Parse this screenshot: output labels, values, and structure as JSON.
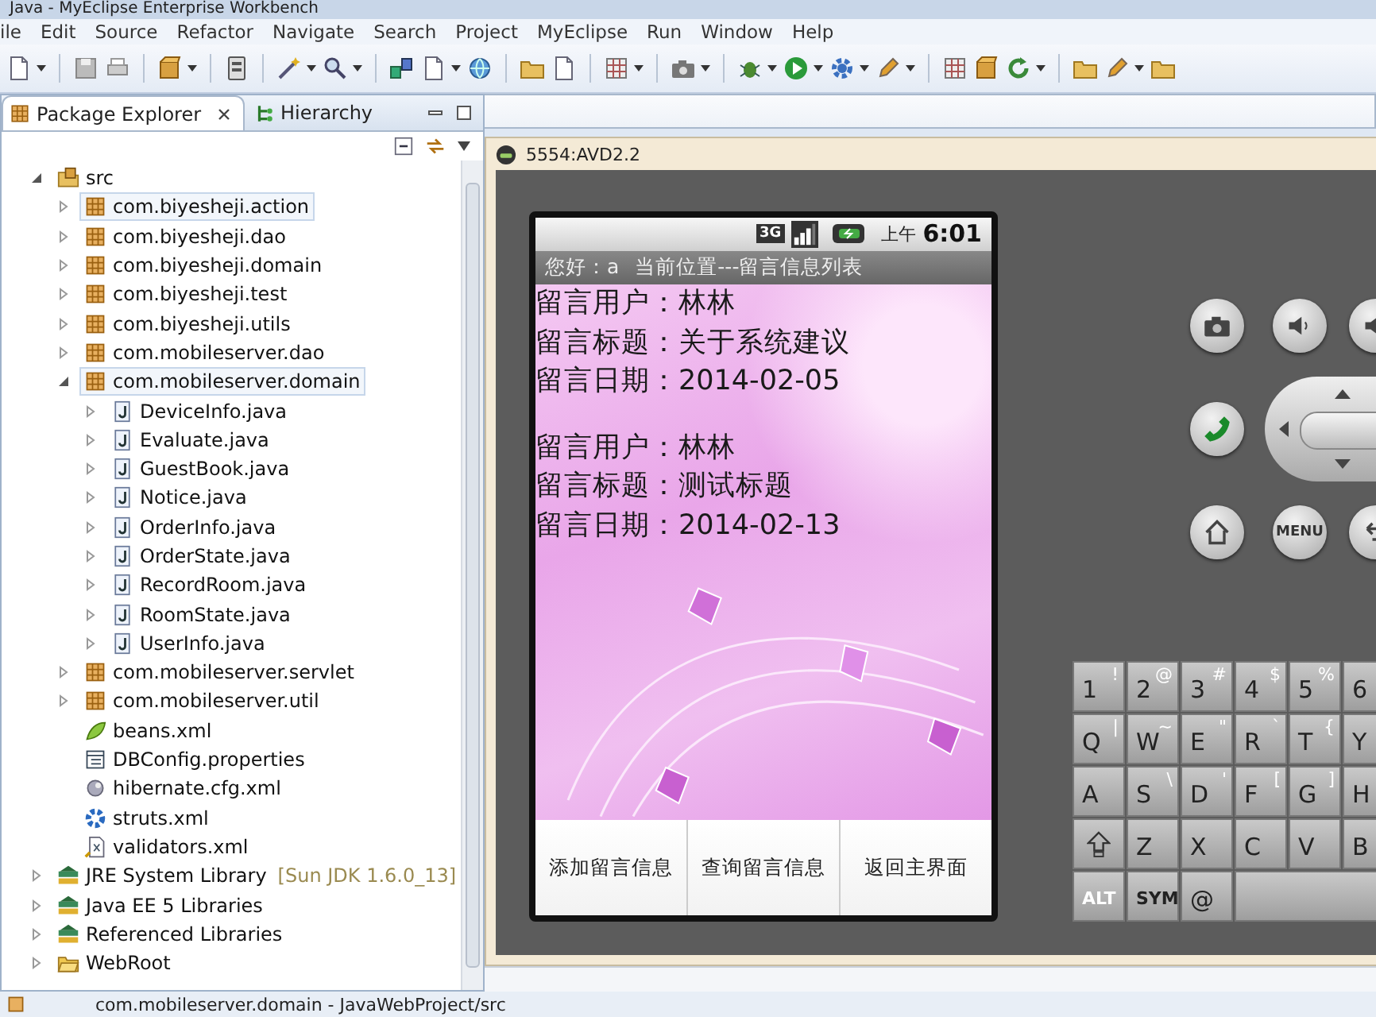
{
  "window": {
    "title": "Java - MyEclipse Enterprise Workbench"
  },
  "menu": [
    "ile",
    "Edit",
    "Source",
    "Refactor",
    "Navigate",
    "Search",
    "Project",
    "MyEclipse",
    "Run",
    "Window",
    "Help"
  ],
  "explorer": {
    "tabs": [
      {
        "label": "Package Explorer",
        "selected": true
      },
      {
        "label": "Hierarchy",
        "selected": false
      }
    ],
    "tree": [
      {
        "label": "src",
        "kind": "source-folder",
        "expanded": true,
        "selected": false,
        "children": [
          {
            "label": "com.biyesheji.action",
            "kind": "package",
            "expanded": false,
            "selected": true
          },
          {
            "label": "com.biyesheji.dao",
            "kind": "package",
            "expanded": false,
            "selected": false
          },
          {
            "label": "com.biyesheji.domain",
            "kind": "package",
            "expanded": false,
            "selected": false
          },
          {
            "label": "com.biyesheji.test",
            "kind": "package",
            "expanded": false,
            "selected": false
          },
          {
            "label": "com.biyesheji.utils",
            "kind": "package",
            "expanded": false,
            "selected": false
          },
          {
            "label": "com.mobileserver.dao",
            "kind": "package",
            "expanded": false,
            "selected": false
          },
          {
            "label": "com.mobileserver.domain",
            "kind": "package",
            "expanded": true,
            "selected": true,
            "children": [
              {
                "label": "DeviceInfo.java",
                "kind": "java",
                "expanded": false,
                "selected": false
              },
              {
                "label": "Evaluate.java",
                "kind": "java",
                "expanded": false,
                "selected": false
              },
              {
                "label": "GuestBook.java",
                "kind": "java",
                "expanded": false,
                "selected": false
              },
              {
                "label": "Notice.java",
                "kind": "java",
                "expanded": false,
                "selected": false
              },
              {
                "label": "OrderInfo.java",
                "kind": "java",
                "expanded": false,
                "selected": false
              },
              {
                "label": "OrderState.java",
                "kind": "java",
                "expanded": false,
                "selected": false
              },
              {
                "label": "RecordRoom.java",
                "kind": "java",
                "expanded": false,
                "selected": false
              },
              {
                "label": "RoomState.java",
                "kind": "java",
                "expanded": false,
                "selected": false
              },
              {
                "label": "UserInfo.java",
                "kind": "java",
                "expanded": false,
                "selected": false
              }
            ]
          },
          {
            "label": "com.mobileserver.servlet",
            "kind": "package",
            "expanded": false,
            "selected": false
          },
          {
            "label": "com.mobileserver.util",
            "kind": "package",
            "expanded": false,
            "selected": false
          },
          {
            "label": "beans.xml",
            "kind": "beans",
            "selected": false
          },
          {
            "label": "DBConfig.properties",
            "kind": "properties",
            "selected": false
          },
          {
            "label": "hibernate.cfg.xml",
            "kind": "hibernate",
            "selected": false
          },
          {
            "label": "struts.xml",
            "kind": "struts",
            "selected": false
          },
          {
            "label": "validators.xml",
            "kind": "validators",
            "selected": false
          }
        ]
      },
      {
        "label": "JRE System Library",
        "decoration": "[Sun JDK 1.6.0_13]",
        "kind": "library",
        "expanded": false,
        "selected": false
      },
      {
        "label": "Java EE 5 Libraries",
        "kind": "library",
        "expanded": false,
        "selected": false
      },
      {
        "label": "Referenced Libraries",
        "kind": "library",
        "expanded": false,
        "selected": false
      },
      {
        "label": "WebRoot",
        "kind": "folder",
        "expanded": false,
        "selected": false
      }
    ]
  },
  "emulator": {
    "title": "5554:AVD2.2",
    "phone": {
      "network": "3G",
      "period": "上午",
      "time": "6:01",
      "greeting": "您好：a",
      "location": "当前位置---留言信息列表",
      "records": [
        {
          "lines": [
            "留言用户：林林",
            "留言标题：关于系统建议",
            "留言日期：2014-02-05"
          ]
        },
        {
          "lines": [
            "留言用户：林林",
            "留言标题：测试标题",
            "留言日期：2014-02-13"
          ]
        }
      ],
      "buttons": [
        "添加留言信息",
        "查询留言信息",
        "返回主界面"
      ]
    },
    "menu_key": "MENU",
    "keyboard": [
      [
        {
          "kind": "char",
          "main": "1",
          "alt": "!"
        },
        {
          "kind": "char",
          "main": "2",
          "alt": "@"
        },
        {
          "kind": "char",
          "main": "3",
          "alt": "#"
        },
        {
          "kind": "char",
          "main": "4",
          "alt": "$"
        },
        {
          "kind": "char",
          "main": "5",
          "alt": "%"
        },
        {
          "kind": "char",
          "main": "6"
        }
      ],
      [
        {
          "kind": "char",
          "main": "Q",
          "alt": "|"
        },
        {
          "kind": "char",
          "main": "W",
          "alt": "~"
        },
        {
          "kind": "char",
          "main": "E",
          "alt": "\""
        },
        {
          "kind": "char",
          "main": "R",
          "alt": "`"
        },
        {
          "kind": "char",
          "main": "T",
          "alt": "{"
        },
        {
          "kind": "char",
          "main": "Y"
        }
      ],
      [
        {
          "kind": "char",
          "main": "A"
        },
        {
          "kind": "char",
          "main": "S",
          "alt": "\\"
        },
        {
          "kind": "char",
          "main": "D",
          "alt": "'"
        },
        {
          "kind": "char",
          "main": "F",
          "alt": "["
        },
        {
          "kind": "char",
          "main": "G",
          "alt": "]"
        },
        {
          "kind": "char",
          "main": "H"
        }
      ],
      [
        {
          "kind": "shift"
        },
        {
          "kind": "char",
          "main": "Z"
        },
        {
          "kind": "char",
          "main": "X"
        },
        {
          "kind": "char",
          "main": "C"
        },
        {
          "kind": "char",
          "main": "V"
        },
        {
          "kind": "char",
          "main": "B"
        }
      ],
      [
        {
          "kind": "mod",
          "main": "ALT"
        },
        {
          "kind": "mod",
          "main": "SYM"
        },
        {
          "kind": "char",
          "main": "@"
        },
        {
          "kind": "space"
        }
      ]
    ]
  },
  "status_bar": {
    "text": "com.mobileserver.domain - JavaWebProject/src"
  }
}
